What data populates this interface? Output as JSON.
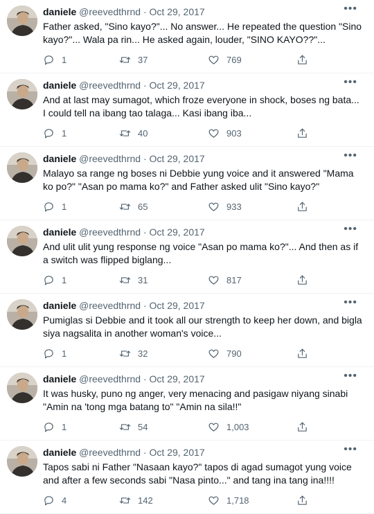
{
  "tweets": [
    {
      "name": "daniele",
      "handle": "@reevedthrnd",
      "sep": " · ",
      "date": "Oct 29, 2017",
      "text": "Father asked, \"Sino kayo?\"... No answer... He repeated the question \"Sino kayo?\"... Wala pa rin... He asked again, louder, \"SINO KAYO??\"...",
      "replies": "1",
      "retweets": "37",
      "likes": "769"
    },
    {
      "name": "daniele",
      "handle": "@reevedthrnd",
      "sep": " · ",
      "date": "Oct 29, 2017",
      "text": "And at last may sumagot, which froze everyone in shock, boses ng bata... I could tell na ibang tao talaga... Kasi ibang iba...",
      "replies": "1",
      "retweets": "40",
      "likes": "903"
    },
    {
      "name": "daniele",
      "handle": "@reevedthrnd",
      "sep": " · ",
      "date": "Oct 29, 2017",
      "text": "Malayo sa range ng boses ni Debbie yung voice and it answered \"Mama ko po?\" \"Asan po mama ko?\" and Father asked ulit \"Sino kayo?\"",
      "replies": "1",
      "retweets": "65",
      "likes": "933"
    },
    {
      "name": "daniele",
      "handle": "@reevedthrnd",
      "sep": " · ",
      "date": "Oct 29, 2017",
      "text": "And ulit ulit yung response ng voice \"Asan po mama ko?\"... And then as if a switch was flipped biglang...",
      "replies": "1",
      "retweets": "31",
      "likes": "817"
    },
    {
      "name": "daniele",
      "handle": "@reevedthrnd",
      "sep": " · ",
      "date": "Oct 29, 2017",
      "text": "Pumiglas si Debbie and it took all our strength to keep her down, and bigla siya nagsalita in another woman's voice...",
      "replies": "1",
      "retweets": "32",
      "likes": "790"
    },
    {
      "name": "daniele",
      "handle": "@reevedthrnd",
      "sep": " · ",
      "date": "Oct 29, 2017",
      "text": "It was husky, puno ng anger, very menacing and pasigaw niyang sinabi \"Amin na 'tong mga batang to\" \"Amin na sila!!\"",
      "replies": "1",
      "retweets": "54",
      "likes": "1,003"
    },
    {
      "name": "daniele",
      "handle": "@reevedthrnd",
      "sep": " · ",
      "date": "Oct 29, 2017",
      "text": "Tapos sabi ni Father \"Nasaan kayo?\" tapos di agad sumagot yung voice and after a few seconds sabi \"Nasa pinto...\" and tang ina tang ina!!!!",
      "replies": "4",
      "retweets": "142",
      "likes": "1,718"
    }
  ],
  "icons": {
    "more": "more-icon",
    "reply": "reply-icon",
    "retweet": "retweet-icon",
    "like": "like-icon",
    "share": "share-icon"
  }
}
